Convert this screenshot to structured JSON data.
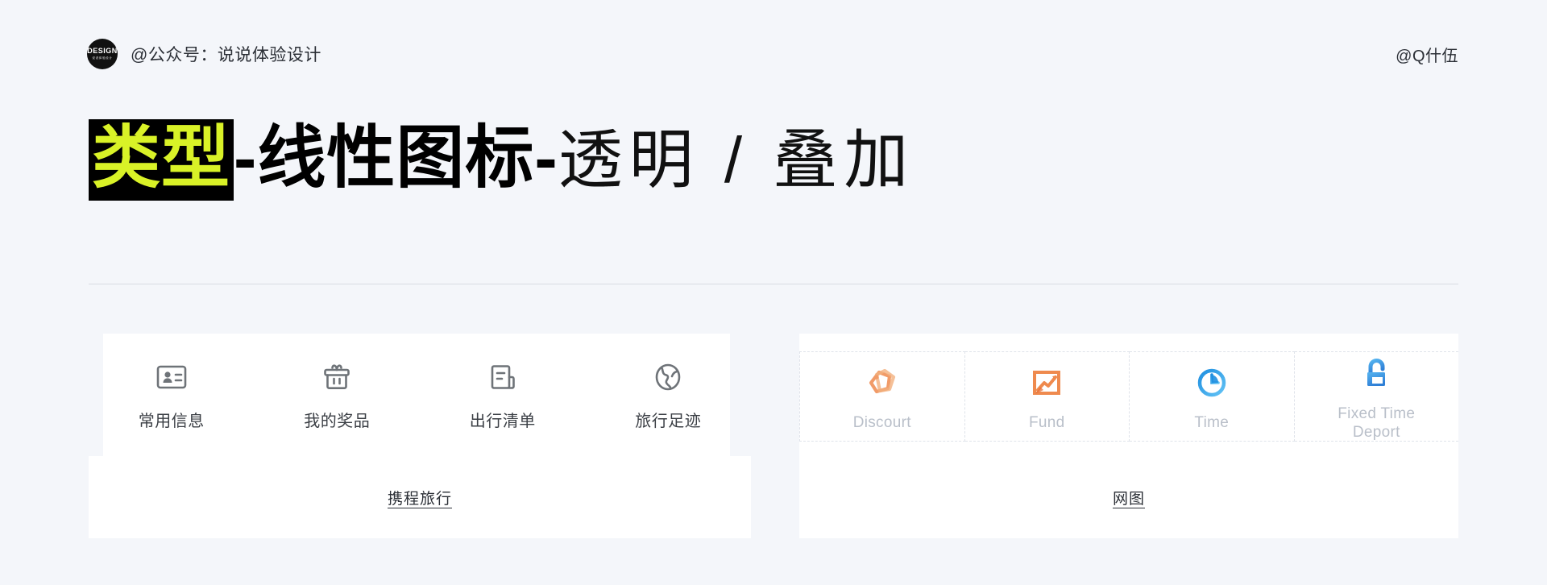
{
  "header": {
    "logo_main": "DESIGN",
    "logo_sub": "说说体验设计",
    "brand_text": "@公众号：说说体验设计",
    "handle": "@Q什伍"
  },
  "title": {
    "highlight": "类型",
    "bold": "-线性图标-",
    "thin": "透明 / 叠加",
    "highlight_bg": "#000000",
    "highlight_color": "#d9f227"
  },
  "cards": [
    {
      "name": "ctrip-card",
      "caption": "携程旅行",
      "items": [
        {
          "label": "常用信息",
          "icon": "id-card-icon"
        },
        {
          "label": "我的奖品",
          "icon": "gift-icon"
        },
        {
          "label": "出行清单",
          "icon": "checklist-icon"
        },
        {
          "label": "旅行足迹",
          "icon": "globe-icon"
        }
      ]
    },
    {
      "name": "webimage-card",
      "caption": "网图",
      "items": [
        {
          "label": "Discourt",
          "icon": "discount-tag-icon",
          "color": "#ef8a4e"
        },
        {
          "label": "Fund",
          "icon": "fund-chart-icon",
          "color": "#ef8a4e"
        },
        {
          "label": "Time",
          "icon": "clock-icon",
          "color": "#2b9ae8"
        },
        {
          "label": "Fixed Time\nDeport",
          "icon": "unlock-icon",
          "color": "#3d9ae8"
        }
      ]
    }
  ]
}
